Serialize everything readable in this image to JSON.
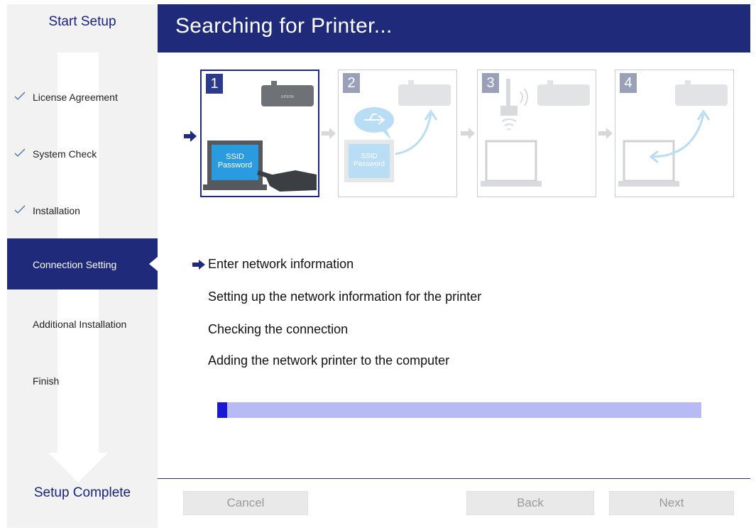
{
  "window": {
    "title": "Searching for Printer..."
  },
  "sidebar": {
    "start_label": "Start Setup",
    "complete_label": "Setup Complete",
    "steps": [
      {
        "label": "License Agreement",
        "state": "done"
      },
      {
        "label": "System Check",
        "state": "done"
      },
      {
        "label": "Installation",
        "state": "done"
      },
      {
        "label": "Connection Setting",
        "state": "active"
      },
      {
        "label": "Additional Installation",
        "state": "pending"
      },
      {
        "label": "Finish",
        "state": "pending"
      }
    ]
  },
  "illustration": {
    "panels": [
      {
        "number": "1",
        "ssid_label": "SSID",
        "password_label": "Password",
        "state": "active",
        "icon": "laptop-ssid-hand-icon"
      },
      {
        "number": "2",
        "ssid_label": "SSID",
        "password_label": "Password",
        "state": "dim",
        "icon": "usb-transfer-icon"
      },
      {
        "number": "3",
        "state": "dim",
        "icon": "router-wireless-icon"
      },
      {
        "number": "4",
        "state": "dim",
        "icon": "printer-connect-icon"
      }
    ],
    "printer_brand": "EPSON"
  },
  "tasks": {
    "items": [
      {
        "label": "Enter network information",
        "current": true
      },
      {
        "label": "Setting up the network information for the printer",
        "current": false
      },
      {
        "label": "Checking the connection",
        "current": false
      },
      {
        "label": "Adding the network printer to the computer",
        "current": false
      }
    ]
  },
  "progress": {
    "value_percent": 2
  },
  "footer": {
    "cancel_label": "Cancel",
    "back_label": "Back",
    "next_label": "Next"
  },
  "colors": {
    "accent": "#1f2b7a",
    "progress_fill": "#1a1ad6",
    "progress_track": "#b8baf5",
    "check": "#4a6fb0"
  }
}
